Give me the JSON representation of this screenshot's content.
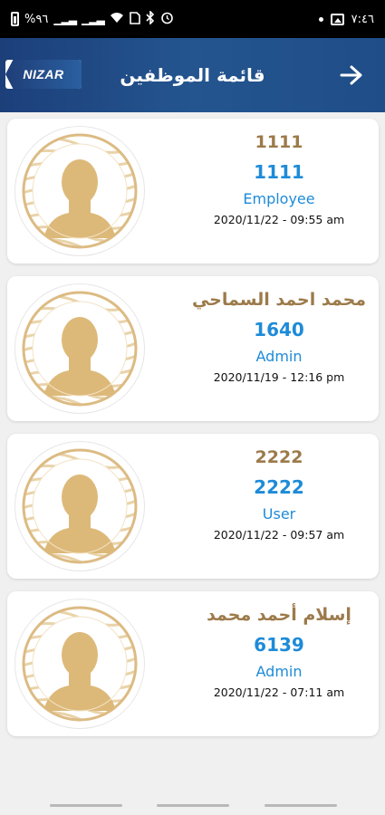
{
  "status_bar": {
    "battery_percent": "%٩٦",
    "time": "٧:٤٦"
  },
  "app_bar": {
    "logo_text": "NIZAR",
    "title": "قائمة الموظفين",
    "back_icon": "arrow-right-icon",
    "gradient_start": "#1c3f7a",
    "gradient_end": "#1f4d87"
  },
  "colors": {
    "name": "#9c7a4a",
    "id": "#1e8bd8",
    "role": "#1e8bd8",
    "avatar_gold": "#ddb979"
  },
  "employees": [
    {
      "name": "1111",
      "id": "1111",
      "role": "Employee",
      "date": "2020/11/22 - 09:55 am"
    },
    {
      "name": "محمد احمد السماحي",
      "id": "1640",
      "role": "Admin",
      "date": "2020/11/19 - 12:16 pm"
    },
    {
      "name": "2222",
      "id": "2222",
      "role": "User",
      "date": "2020/11/22 - 09:57 am"
    },
    {
      "name": "إسلام أحمد محمد",
      "id": "6139",
      "role": "Admin",
      "date": "2020/11/22 - 07:11 am"
    }
  ]
}
